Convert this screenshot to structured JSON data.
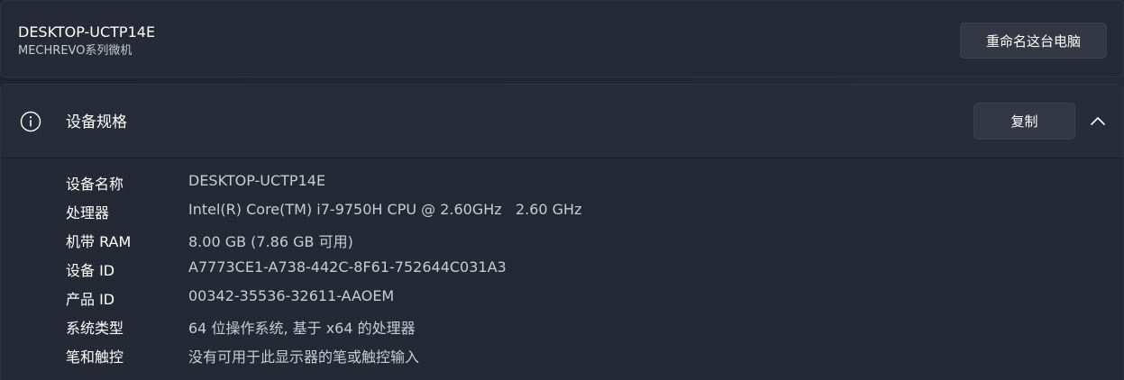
{
  "device_card": {
    "pc_name": "DESKTOP-UCTP14E",
    "pc_model": "MECHREVO系列微机",
    "rename_button": "重命名这台电脑"
  },
  "specs_section": {
    "title": "设备规格",
    "copy_button": "复制",
    "expanded": true,
    "rows": [
      {
        "label": "设备名称",
        "value": "DESKTOP-UCTP14E"
      },
      {
        "label": "处理器",
        "value": "Intel(R) Core(TM) i7-9750H CPU @ 2.60GHz   2.60 GHz"
      },
      {
        "label": "机带 RAM",
        "value": "8.00 GB (7.86 GB 可用)"
      },
      {
        "label": "设备 ID",
        "value": "A7773CE1-A738-442C-8F61-752644C031A3"
      },
      {
        "label": "产品 ID",
        "value": "00342-35536-32611-AAOEM"
      },
      {
        "label": "系统类型",
        "value": "64 位操作系统, 基于 x64 的处理器"
      },
      {
        "label": "笔和触控",
        "value": "没有可用于此显示器的笔或触控输入"
      }
    ]
  },
  "icons": {
    "section_icon": "info-icon",
    "collapse_icon": "chevron-up-icon"
  }
}
